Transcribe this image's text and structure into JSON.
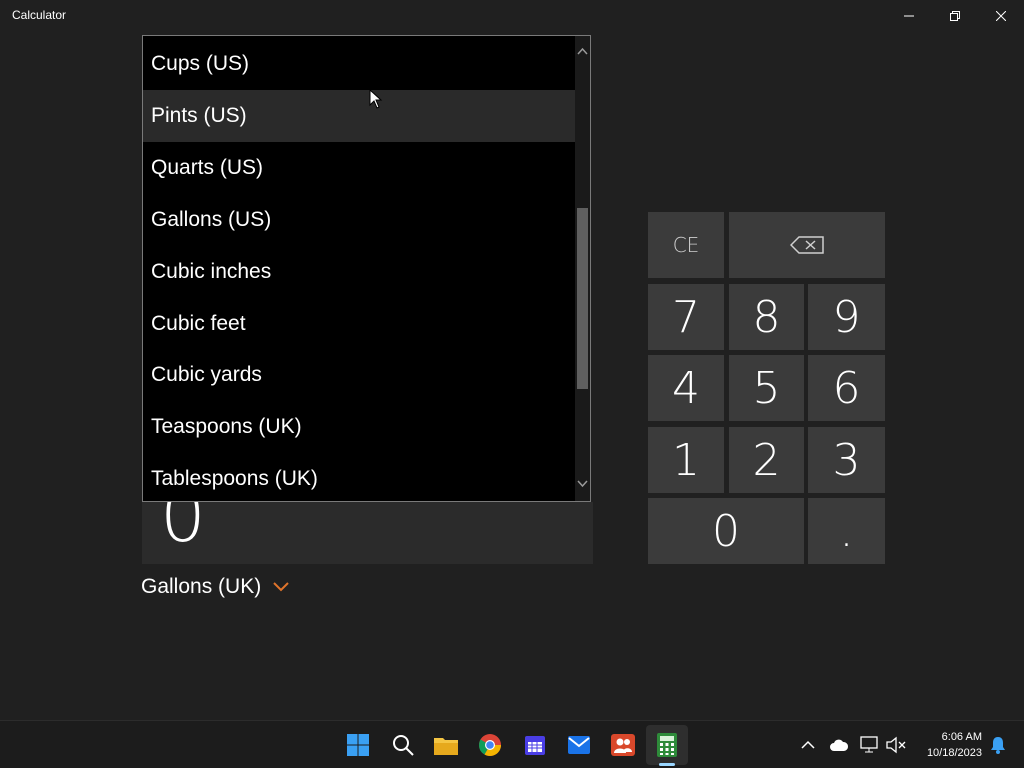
{
  "window": {
    "title": "Calculator"
  },
  "dropdown": {
    "items": [
      {
        "label": "Cups (US)"
      },
      {
        "label": "Pints (US)"
      },
      {
        "label": "Quarts (US)"
      },
      {
        "label": "Gallons (US)"
      },
      {
        "label": "Cubic inches"
      },
      {
        "label": "Cubic feet"
      },
      {
        "label": "Cubic yards"
      },
      {
        "label": "Teaspoons (UK)"
      },
      {
        "label": "Tablespoons (UK)"
      }
    ],
    "hovered_item": "Pints (US)"
  },
  "display": {
    "value": "0"
  },
  "unit_selector": {
    "label": "Gallons (UK)"
  },
  "keypad": {
    "ce": "CE",
    "backspace_icon": "backspace-icon",
    "digits": [
      "7",
      "8",
      "9",
      "4",
      "5",
      "6",
      "1",
      "2",
      "3",
      "0"
    ],
    "decimal": "."
  },
  "taskbar": {
    "apps": [
      "start-icon",
      "search-icon",
      "file-explorer-icon",
      "chrome-icon",
      "calendar-icon",
      "mail-icon",
      "teams-icon",
      "calculator-icon"
    ],
    "active_app": "calculator-icon",
    "time": "6:06 AM",
    "date": "10/18/2023"
  },
  "colors": {
    "accent_chevron": "#e0742b",
    "indicator": "#9ad6ff"
  }
}
